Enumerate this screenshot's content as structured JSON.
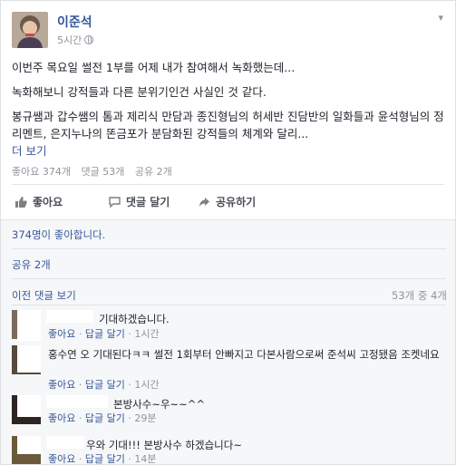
{
  "post": {
    "author": "이준석",
    "time": "5시간",
    "paragraphs": [
      "이번주 목요일 썰전 1부를 어제 내가 참여해서 녹화했는데...",
      "녹화해보니 강적들과 다른 분위기인건 사실인 것 같다.",
      "봉규쌤과 갑수쌤의 톰과 제리식 만담과 종진형님의 허세반 진담반의 일화들과 윤석형님의 정리멘트, 은지누나의 똔금포가 분담화된 강적들의 체계와 달리..."
    ],
    "see_more": "더 보기"
  },
  "stats": {
    "likes": "좋아요 374개",
    "comments": "댓글 53개",
    "shares": "공유 2개"
  },
  "actions": {
    "like": "좋아요",
    "comment": "댓글 달기",
    "share": "공유하기"
  },
  "ufi": {
    "likes_summary": "374명이 좋아합니다.",
    "shares_summary": "공유 2개",
    "prev_comments": "이전 댓글 보기",
    "comment_count": "53개 중 4개"
  },
  "comments": [
    {
      "text": "기대하겠습니다.",
      "like": "좋아요",
      "reply": "답글 달기",
      "time": "1시간"
    },
    {
      "text": "홍수연 오 기대된다ㅋㅋ 썰전 1회부터 안빠지고 다본사람으로써 준석씨 고정됐음 조켓네요",
      "like": "좋아요",
      "reply": "답글 달기",
      "time": "1시간"
    },
    {
      "text": "본방사수~우~~^^",
      "like": "좋아요",
      "reply": "답글 달기",
      "time": "29분"
    },
    {
      "text": "우와 기대!!! 본방사수 하겠습니다~",
      "like": "좋아요",
      "reply": "답글 달기",
      "time": "14분"
    }
  ],
  "colors": {
    "link": "#365899",
    "meta": "#90949c",
    "text": "#1d2129",
    "ufi_bg": "#f6f7f9"
  }
}
